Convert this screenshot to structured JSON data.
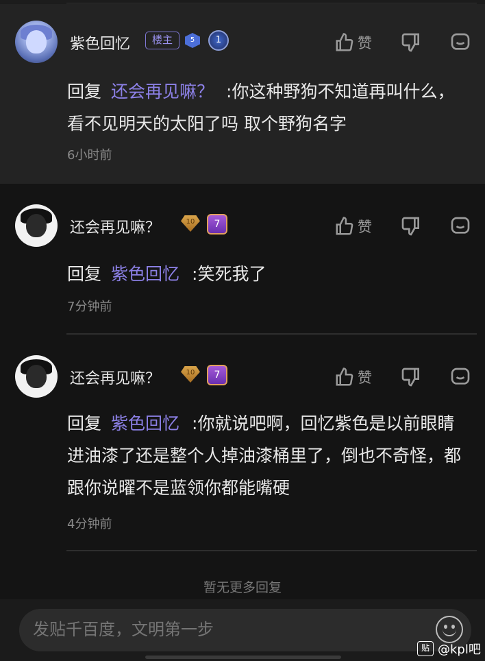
{
  "comments": [
    {
      "username": "紫色回忆",
      "owner_badge": "楼主",
      "gem_level": "5",
      "level": "1",
      "like_label": "赞",
      "reply_prefix": "回复",
      "mention": "还会再见嘛？",
      "text": ":你这种野狗不知道再叫什么，看不见明天的太阳了吗 取个野狗名字",
      "time": "6小时前"
    },
    {
      "username": "还会再见嘛？",
      "gem_level": "10",
      "level": "7",
      "like_label": "赞",
      "reply_prefix": "回复",
      "mention": "紫色回忆",
      "text": ":笑死我了",
      "time": "7分钟前"
    },
    {
      "username": "还会再见嘛？",
      "gem_level": "10",
      "level": "7",
      "like_label": "赞",
      "reply_prefix": "回复",
      "mention": "紫色回忆",
      "text": ":你就说吧啊，回忆紫色是以前眼睛进油漆了还是整个人掉油漆桶里了，倒也不奇怪，都跟你说曜不是蓝领你都能嘴硬",
      "time": "4分钟前"
    }
  ],
  "footer_note": "暂无更多回复",
  "input": {
    "placeholder": "发贴千百度，文明第一步"
  },
  "watermark": {
    "icon": "贴",
    "text": "@kpl吧"
  },
  "colors": {
    "mention": "#8c80e6",
    "background": "#141414",
    "highlight_row": "#232323"
  }
}
